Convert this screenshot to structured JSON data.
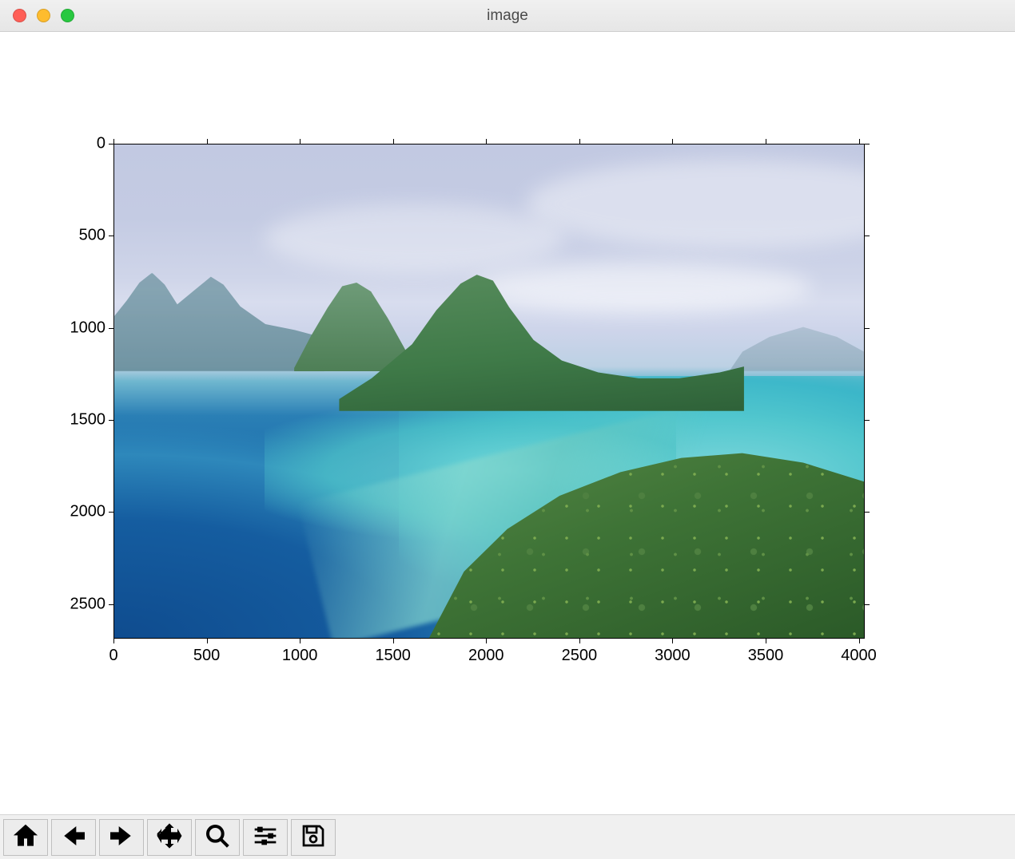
{
  "window": {
    "title": "image"
  },
  "plot": {
    "x_range": [
      0,
      4032
    ],
    "y_range": [
      0,
      2688
    ],
    "x_ticks": [
      0,
      500,
      1000,
      1500,
      2000,
      2500,
      3000,
      3500,
      4000
    ],
    "y_ticks": [
      0,
      500,
      1000,
      1500,
      2000,
      2500
    ]
  },
  "toolbar": {
    "buttons": [
      {
        "id": "home",
        "label": "Home"
      },
      {
        "id": "back",
        "label": "Back"
      },
      {
        "id": "forward",
        "label": "Forward"
      },
      {
        "id": "pan",
        "label": "Pan"
      },
      {
        "id": "zoom",
        "label": "Zoom"
      },
      {
        "id": "subplots",
        "label": "Configure subplots"
      },
      {
        "id": "save",
        "label": "Save"
      }
    ]
  }
}
